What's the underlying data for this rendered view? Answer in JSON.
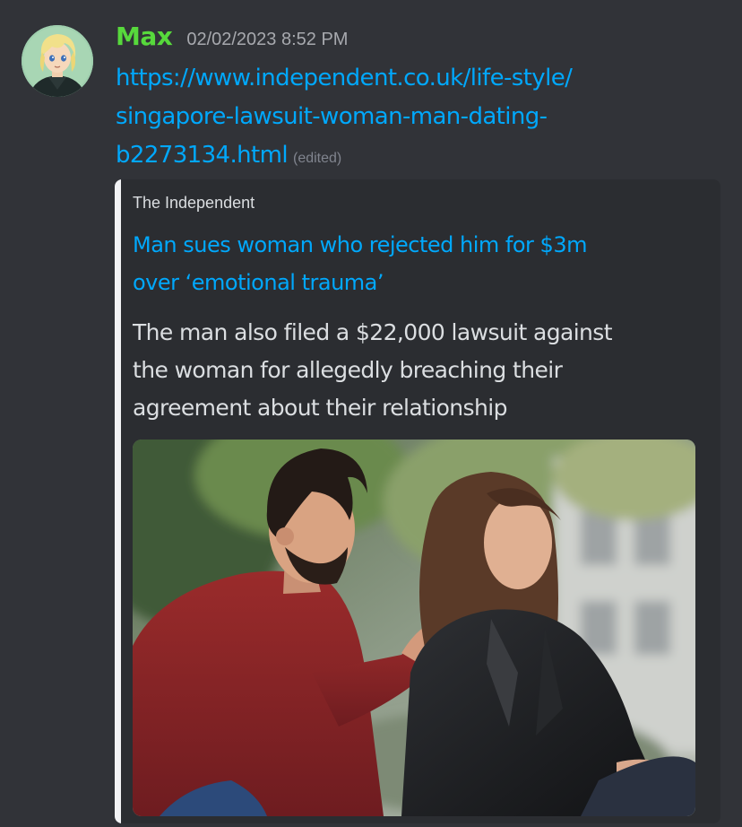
{
  "message": {
    "author": "Max",
    "timestamp": "02/02/2023 8:52 PM",
    "link_lines": [
      "https://www.independent.co.uk/life-style/",
      "singapore-lawsuit-woman-man-dating-",
      "b2273134.html"
    ],
    "edited_label": "(edited)"
  },
  "embed": {
    "provider": "The Independent",
    "title_lines": [
      "Man sues woman who rejected him for $3m",
      "over ‘emotional trauma’"
    ],
    "description_lines": [
      "The man also filed a $22,000 lawsuit against",
      "the woman for allegedly breaching their",
      "agreement about their relationship"
    ],
    "bar_color": "#f2f3f5"
  },
  "colors": {
    "background": "#313338",
    "embed_background": "#2b2d31",
    "username": "#57d93c",
    "link": "#00a8fc",
    "text": "#dbdee1",
    "muted": "#a7a9ae"
  }
}
